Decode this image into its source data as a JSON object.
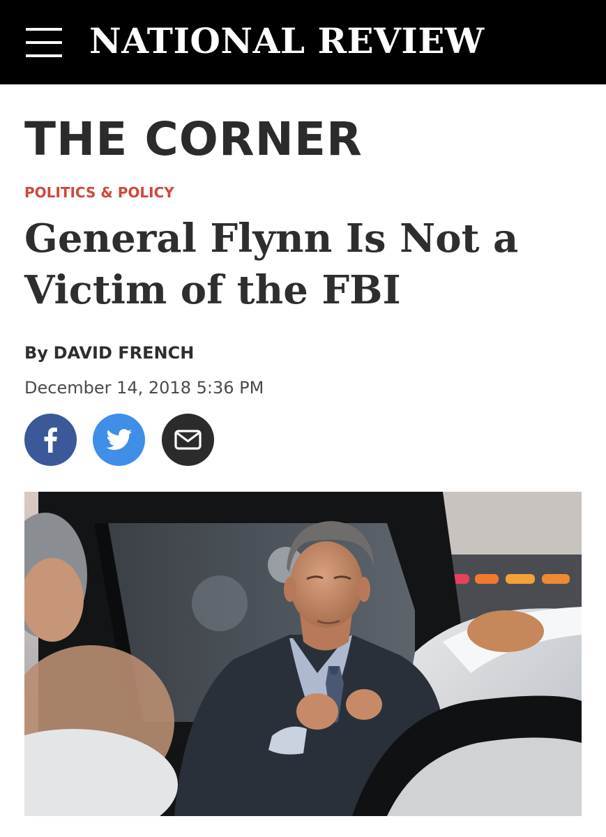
{
  "header": {
    "brand": "NATIONAL REVIEW",
    "menu_icon": "hamburger-menu-icon",
    "background": "#000000"
  },
  "section": {
    "title": "THE CORNER"
  },
  "article": {
    "category": "POLITICS & POLICY",
    "headline": "General Flynn Is Not a Victim of the FBI",
    "byline_prefix": "By",
    "author": "DAVID FRENCH",
    "date": "December 14, 2018 5:36 PM",
    "image_icon": "article-photo"
  },
  "share": [
    {
      "name": "facebook",
      "icon": "facebook-icon",
      "color": "#3b5998"
    },
    {
      "name": "twitter",
      "icon": "twitter-icon",
      "color": "#3f8ee7"
    },
    {
      "name": "email",
      "icon": "mail-icon",
      "color": "#2b2b2b"
    }
  ],
  "colors": {
    "category": "#d0483c",
    "text": "#2e2e2e"
  }
}
